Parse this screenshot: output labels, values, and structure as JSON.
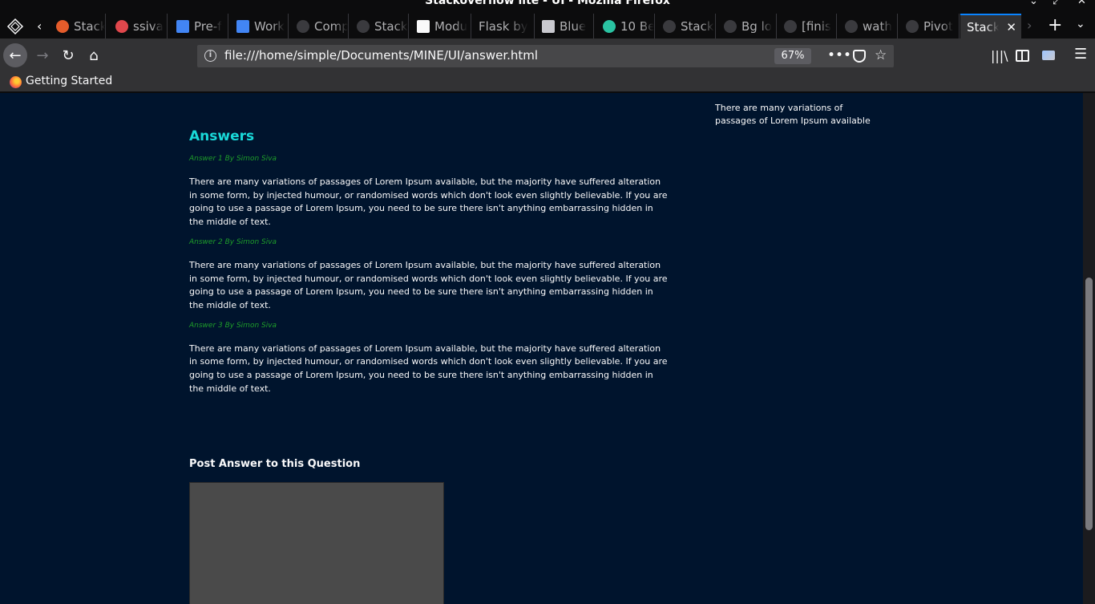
{
  "window": {
    "title": "Stackoverflow lite - UI - Mozilla Firefox"
  },
  "tabs": [
    {
      "label": "Stack",
      "icon": "codepen-icon",
      "color": "#e45c2b"
    },
    {
      "label": "ssiva",
      "icon": "ruby-icon",
      "color": "#e0474c"
    },
    {
      "label": "Pre-f",
      "icon": "google-docs-icon",
      "color": "#4285f4"
    },
    {
      "label": "Work",
      "icon": "google-docs-icon",
      "color": "#4285f4"
    },
    {
      "label": "Comp",
      "icon": "github-icon",
      "color": "#3a3a3e"
    },
    {
      "label": "Stack",
      "icon": "github-icon",
      "color": "#3a3a3e"
    },
    {
      "label": "Modu",
      "icon": "phone-icon",
      "color": "#f9f9fa"
    },
    {
      "label": "Flask by",
      "icon": "",
      "color": ""
    },
    {
      "label": "Blue",
      "icon": "book-icon",
      "color": "#c9c9cf"
    },
    {
      "label": "10 Be",
      "icon": "alien-icon",
      "color": "#2ac3a2"
    },
    {
      "label": "Stack",
      "icon": "github-icon",
      "color": "#3a3a3e"
    },
    {
      "label": "Bg lo",
      "icon": "github-icon",
      "color": "#3a3a3e"
    },
    {
      "label": "[finis",
      "icon": "github-icon",
      "color": "#3a3a3e"
    },
    {
      "label": "wath",
      "icon": "github-icon",
      "color": "#3a3a3e"
    },
    {
      "label": "Pivot",
      "icon": "github-icon",
      "color": "#3a3a3e"
    },
    {
      "label": "Stack",
      "icon": "",
      "color": "",
      "active": true
    }
  ],
  "nav": {
    "url": "file:///home/simple/Documents/MINE/UI/answer.html",
    "zoom": "67%"
  },
  "bookmarks": {
    "getting_started": "Getting Started"
  },
  "page": {
    "side_text": "There are many variations of passages of Lorem Ipsum available",
    "answers_heading": "Answers",
    "answers": [
      {
        "meta": "Answer 1 By Simon Siva",
        "body": "There are many variations of passages of Lorem Ipsum available, but the majority have suffered alteration in some form, by injected humour, or randomised words which don't look even slightly believable. If you are going to use a passage of Lorem Ipsum, you need to be sure there isn't anything embarrassing hidden in the middle of text."
      },
      {
        "meta": "Answer 2 By Simon Siva",
        "body": "There are many variations of passages of Lorem Ipsum available, but the majority have suffered alteration in some form, by injected humour, or randomised words which don't look even slightly believable. If you are going to use a passage of Lorem Ipsum, you need to be sure there isn't anything embarrassing hidden in the middle of text."
      },
      {
        "meta": "Answer 3 By Simon Siva",
        "body": "There are many variations of passages of Lorem Ipsum available, but the majority have suffered alteration in some form, by injected humour, or randomised words which don't look even slightly believable. If you are going to use a passage of Lorem Ipsum, you need to be sure there isn't anything embarrassing hidden in the middle of text."
      }
    ],
    "post_heading": "Post Answer to this Question"
  }
}
